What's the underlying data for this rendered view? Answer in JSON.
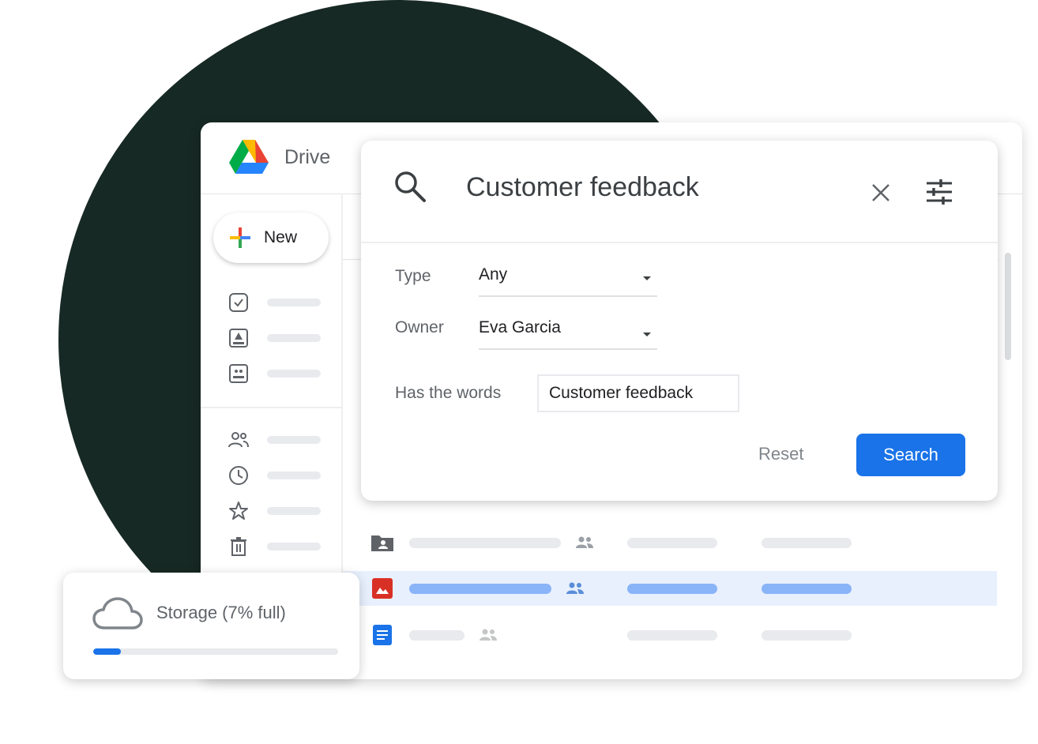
{
  "app": {
    "name": "Drive"
  },
  "sidebar": {
    "new_label": "New",
    "items": [
      {
        "icon": "priority-icon"
      },
      {
        "icon": "my-drive-icon"
      },
      {
        "icon": "computers-icon"
      },
      {
        "icon": "shared-with-me-icon"
      },
      {
        "icon": "recent-icon"
      },
      {
        "icon": "starred-icon"
      },
      {
        "icon": "trash-icon"
      }
    ]
  },
  "search": {
    "query": "Customer feedback",
    "type_label": "Type",
    "type_value": "Any",
    "owner_label": "Owner",
    "owner_value": "Eva Garcia",
    "words_label": "Has the words",
    "words_value": "Customer feedback",
    "reset_label": "Reset",
    "search_label": "Search"
  },
  "files": [
    {
      "icon": "shared-folder-icon",
      "selected": false
    },
    {
      "icon": "image-file-icon",
      "selected": true
    },
    {
      "icon": "docs-file-icon",
      "selected": false
    }
  ],
  "storage": {
    "label": "Storage (7% full)",
    "percent_used": 7
  },
  "colors": {
    "accent": "#1a73e8",
    "selected_row": "#e8f0fe",
    "background_circle": "#172924",
    "image_file": "#d93025"
  }
}
